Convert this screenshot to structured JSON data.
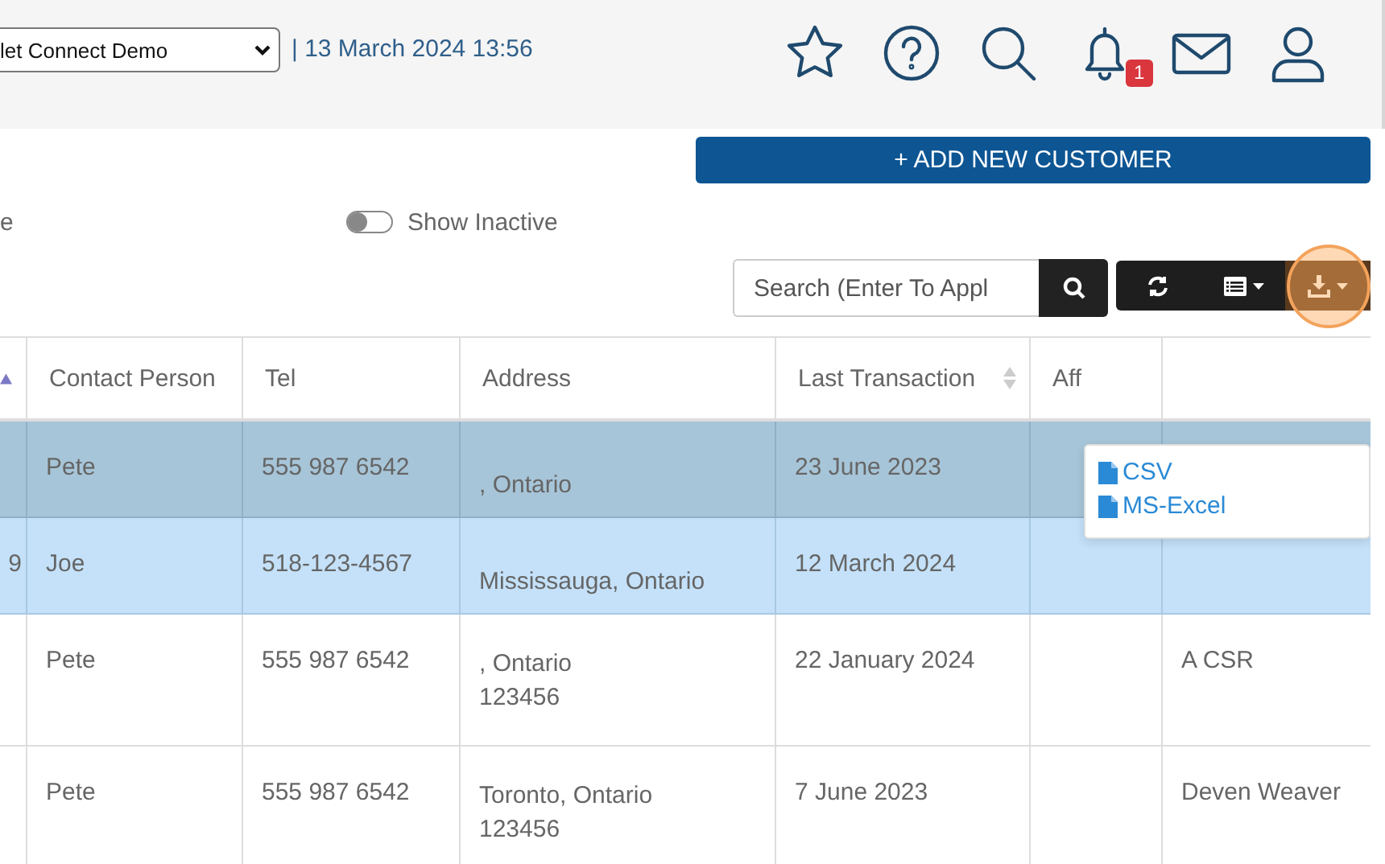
{
  "header": {
    "location_select": {
      "value": "let Connect Demo"
    },
    "datetime": "| 13 March 2024 13:56",
    "notifications_badge": "1"
  },
  "add_button": "+ ADD NEW CUSTOMER",
  "filter_label": "e",
  "show_inactive": {
    "label": "Show Inactive",
    "on": false
  },
  "search": {
    "placeholder": "Search (Enter To Appl"
  },
  "toolbar": [
    {
      "kind": "refresh",
      "highlighted": false
    },
    {
      "kind": "columns",
      "highlighted": false
    },
    {
      "kind": "download",
      "highlighted": true
    }
  ],
  "export_menu": {
    "open": true,
    "items": [
      "CSV",
      "MS-Excel"
    ]
  },
  "table": {
    "columns": [
      {
        "sortable": true,
        "sorted_ascending": true
      },
      {
        "label": "Contact Person",
        "sortable": false,
        "sorted_ascending": false
      },
      {
        "label": "Tel",
        "sortable": false,
        "sorted_ascending": false
      },
      {
        "label": "Address",
        "sortable": false,
        "sorted_ascending": false
      },
      {
        "label": "Last Transaction",
        "sortable": true,
        "sorted_ascending": false
      },
      {
        "label": "Aff",
        "sortable": false,
        "sorted_ascending": false
      },
      {
        "sortable": false,
        "sorted_ascending": false
      }
    ],
    "rows": [
      {
        "selected": false,
        "hovered": true,
        "cells": [
          "",
          "Pete",
          "555 987 6542",
          [
            ", Ontario"
          ],
          "23 June 2023",
          "",
          ""
        ]
      },
      {
        "selected": true,
        "hovered": false,
        "cells": [
          "9",
          "Joe",
          "518-123-4567",
          [
            "Mississauga, Ontario"
          ],
          "12 March 2024",
          "",
          ""
        ]
      },
      {
        "selected": false,
        "hovered": false,
        "cells": [
          "",
          "Pete",
          "555 987 6542",
          [
            ", Ontario",
            "123456"
          ],
          "22 January 2024",
          "",
          "A CSR"
        ]
      },
      {
        "selected": false,
        "hovered": false,
        "cells": [
          "",
          "Pete",
          "555 987 6542",
          [
            "Toronto, Ontario",
            "123456"
          ],
          "7 June 2023",
          "",
          "Deven Weaver"
        ]
      }
    ]
  }
}
